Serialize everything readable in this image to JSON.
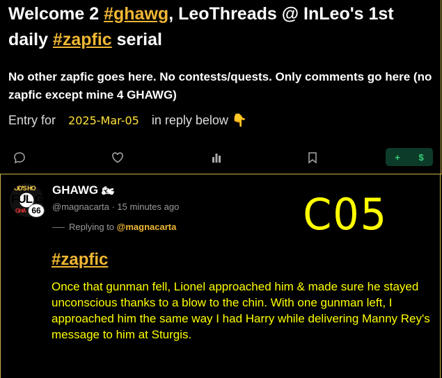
{
  "post": {
    "title_parts": {
      "p1": "Welcome 2 ",
      "tag1": "#ghawg",
      "p2": ", LeoThreads @ InLeo's 1st daily ",
      "tag2": "#zapfic",
      "p3": " serial"
    },
    "subtitle": "No other zapfic goes here. No contests/quests. Only comments go here (no zapfic except mine 4 GHAWG)",
    "entry_prefix": "Entry for",
    "entry_date": "2025-Mar-05",
    "entry_suffix": "in reply below 👇",
    "tip_plus": "+",
    "tip_dollar": "$"
  },
  "reply": {
    "username": "GHAWG",
    "username_emoji": "🏍",
    "badge": "66",
    "handle": "@magnacarta",
    "time": "15 minutes ago",
    "replying_prefix": "Replying to",
    "replying_handle": "@magnacarta",
    "overlay_code": "C05",
    "hashtag": "#zapfic",
    "body": "Once that gunman fell, Lionel approached him & made sure he stayed unconscious thanks to a blow to the chin. With one gunman left, I approached him the same way I had Harry while delivering Manny Rey's message to him at Sturgis."
  },
  "avatar_text": {
    "top": "OD'S HO",
    "mid": "FUL G",
    "bottom": "GHA"
  },
  "colors": {
    "accent": "#f0b733",
    "highlight": "#ffff00",
    "border": "#c9b24a",
    "tip_bg": "#0d3b2a",
    "tip_fg": "#34d178"
  },
  "icons": [
    "comment-icon",
    "heart-icon",
    "stats-icon",
    "bookmark-icon"
  ]
}
